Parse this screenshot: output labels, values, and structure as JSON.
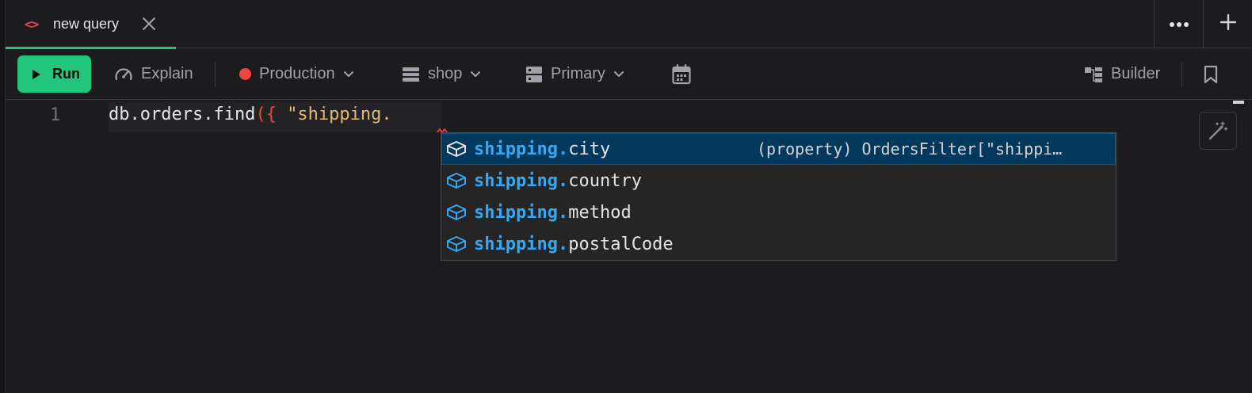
{
  "tab": {
    "code_glyph": "<>",
    "label": "new query"
  },
  "toolbar": {
    "run_label": "Run",
    "explain_label": "Explain",
    "environment_label": "Production",
    "database_label": "shop",
    "replica_label": "Primary",
    "builder_label": "Builder"
  },
  "editor": {
    "line_number": "1",
    "code": {
      "prefix": "db.orders.find",
      "paren": "(",
      "brace": "{",
      "space": " ",
      "string": "\"shipping."
    }
  },
  "suggestions": {
    "items": [
      {
        "match": "shipping.",
        "rest": "city",
        "selected": true
      },
      {
        "match": "shipping.",
        "rest": "country",
        "selected": false
      },
      {
        "match": "shipping.",
        "rest": "method",
        "selected": false
      },
      {
        "match": "shipping.",
        "rest": "postalCode",
        "selected": false
      }
    ],
    "detail": "(property) OrdersFilter[\"shippi…"
  },
  "colors": {
    "accent_green": "#22c57c",
    "error_red": "#ef4444",
    "suggest_match_blue": "#39a6f2",
    "selected_row": "#04395e",
    "string_orange": "#e6b673"
  },
  "icons": [
    "code-icon",
    "close-icon",
    "more-icon",
    "plus-icon",
    "play-icon",
    "gauge-icon",
    "chevron-down-icon",
    "database-icon",
    "server-icon",
    "calendar-icon",
    "builder-icon",
    "bookmark-icon",
    "magic-wand-icon",
    "property-icon"
  ]
}
